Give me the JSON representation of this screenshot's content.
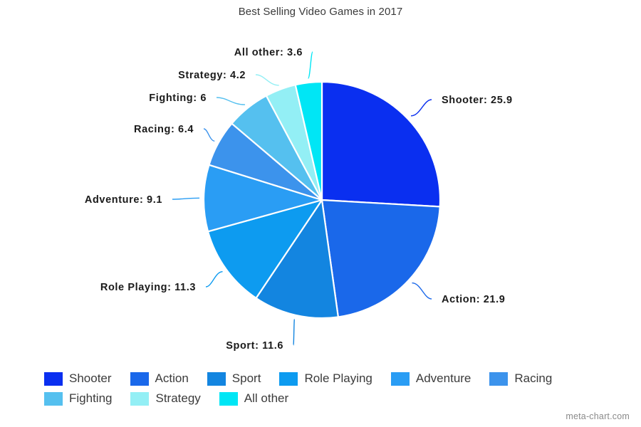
{
  "chart_data": {
    "type": "pie",
    "title": "Best Selling Video Games in 2017",
    "categories": [
      "Shooter",
      "Action",
      "Sport",
      "Role Playing",
      "Adventure",
      "Racing",
      "Fighting",
      "Strategy",
      "All other"
    ],
    "values": [
      25.9,
      21.9,
      11.6,
      11.3,
      9.1,
      6.4,
      6,
      4.2,
      3.6
    ],
    "labels": [
      "Shooter: 25.9",
      "Action: 21.9",
      "Sport: 11.6",
      "Role Playing: 11.3",
      "Adventure: 9.1",
      "Racing: 6.4",
      "Fighting: 6",
      "Strategy: 4.2",
      "All other: 3.6"
    ],
    "colors": [
      "#0a2ff0",
      "#1a68ea",
      "#1385e0",
      "#0d9bf0",
      "#2a9df4",
      "#3c93ec",
      "#55c0ef",
      "#93eff5",
      "#00e6f5"
    ],
    "start_angle": 0,
    "direction": "clockwise",
    "slice_border_color": "#ffffff",
    "legend_position": "bottom",
    "grid": false,
    "xlabel": "",
    "ylabel": ""
  },
  "legend": {
    "rows": [
      [
        {
          "label": "Shooter",
          "color": "#0a2ff0"
        },
        {
          "label": "Action",
          "color": "#1a68ea"
        },
        {
          "label": "Sport",
          "color": "#1385e0"
        },
        {
          "label": "Role Playing",
          "color": "#0d9bf0"
        },
        {
          "label": "Adventure",
          "color": "#2a9df4"
        },
        {
          "label": "Racing",
          "color": "#3c93ec"
        }
      ],
      [
        {
          "label": "Fighting",
          "color": "#55c0ef"
        },
        {
          "label": "Strategy",
          "color": "#93eff5"
        },
        {
          "label": "All other",
          "color": "#00e6f5"
        }
      ]
    ]
  },
  "watermark": {
    "text": "meta-chart.com"
  }
}
